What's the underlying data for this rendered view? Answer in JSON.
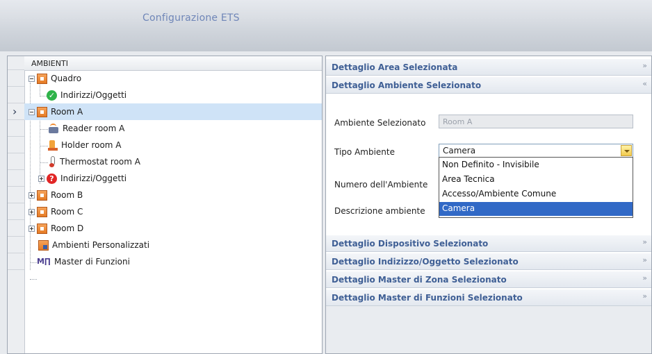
{
  "window": {
    "title": "Configurazione ETS"
  },
  "tree": {
    "header": "AMBIENTI",
    "nodes": [
      {
        "label": "Quadro"
      },
      {
        "label": "Indirizzi/Oggetti"
      },
      {
        "label": "Room A"
      },
      {
        "label": "Reader room A"
      },
      {
        "label": "Holder room A"
      },
      {
        "label": "Thermostat room A"
      },
      {
        "label": "Indirizzi/Oggetti"
      },
      {
        "label": "Room B"
      },
      {
        "label": "Room C"
      },
      {
        "label": "Room D"
      },
      {
        "label": "Ambienti Personalizzati"
      },
      {
        "label": "Master di Funzioni"
      }
    ]
  },
  "sections": {
    "area": {
      "label": "Dettaglio Area Selezionata"
    },
    "ambiente": {
      "label": "Dettaglio Ambiente Selezionato"
    },
    "dispositivo": {
      "label": "Dettaglio Dispositivo Selezionato"
    },
    "indirizzo": {
      "label": "Dettaglio Indizizzo/Oggetto Selezionato"
    },
    "master_zona": {
      "label": "Dettaglio Master di Zona Selezionato"
    },
    "master_funzioni": {
      "label": "Dettaglio Master di Funzioni Selezionato"
    }
  },
  "form": {
    "ambiente_label": "Ambiente Selezionato",
    "ambiente_value": "Room A",
    "tipo_label": "Tipo Ambiente",
    "tipo_value": "Camera",
    "numero_label": "Numero dell'Ambiente",
    "descrizione_label": "Descrizione ambiente",
    "tipo_options": [
      "Non Definito - Invisibile",
      "Area Tecnica",
      "Accesso/Ambiente Comune",
      "Camera"
    ]
  }
}
